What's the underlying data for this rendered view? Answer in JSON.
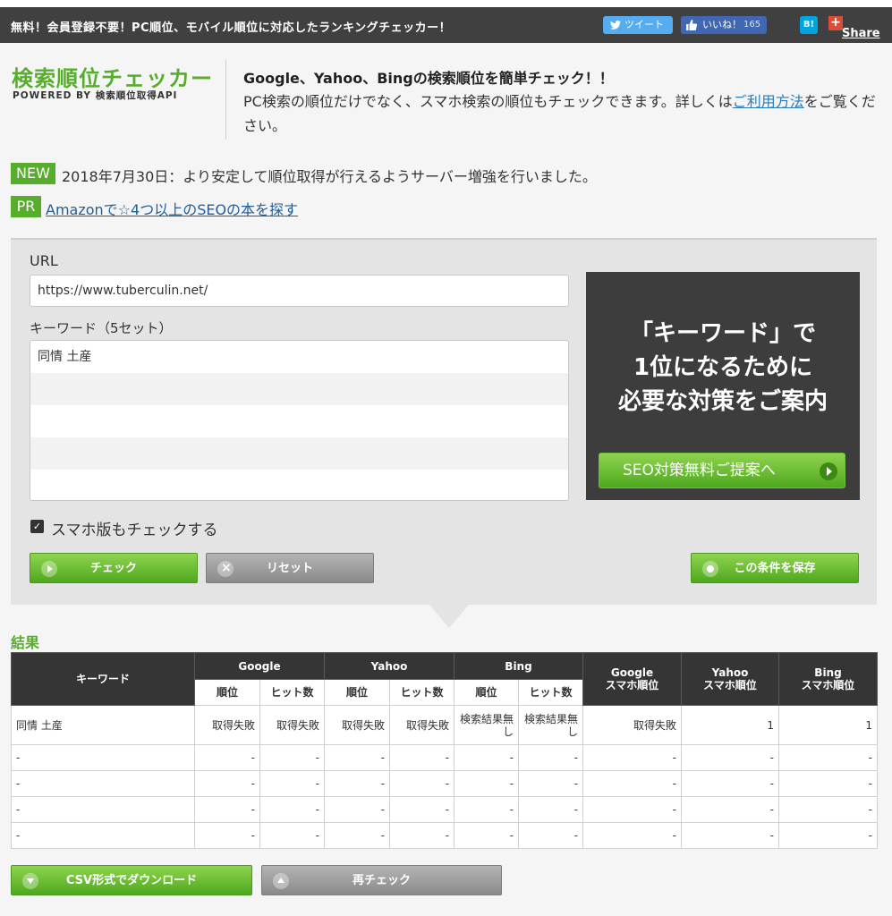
{
  "topbar": {
    "tagline": "無料！会員登録不要！PC順位、モバイル順位に対応したランキングチェッカー！",
    "tweet_label": "ツイート",
    "like_label": "いいね！",
    "like_count": "165",
    "hatena_label": "B!",
    "gplus_plus": "+",
    "share_label": "Share"
  },
  "header": {
    "logo_title": "検索順位チェッカー",
    "logo_sub": "POWERED BY 検索順位取得API",
    "intro_heading": "Google、Yahoo、Bingの検索順位を簡単チェック！！",
    "intro_text": "PC検索の順位だけでなく、スマホ検索の順位もチェックできます。詳しくは",
    "intro_link": "ご利用方法",
    "intro_tail": "をご覧ください。"
  },
  "news": {
    "new_badge": "NEW",
    "new_text": "2018年7月30日：より安定して順位取得が行えるようサーバー増強を行いました。",
    "pr_badge": "PR",
    "pr_link": "Amazonで☆4つ以上のSEOの本を探す"
  },
  "form": {
    "url_label": "URL",
    "url_value": "https://www.tuberculin.net/",
    "keyword_label": "キーワード（5セット）",
    "keywords": [
      "同情 土産",
      "",
      "",
      "",
      ""
    ],
    "smartphone_check_label": "スマホ版もチェックする",
    "smartphone_checked": true,
    "check_button": "チェック",
    "reset_button": "リセット",
    "save_button": "この条件を保存"
  },
  "ad": {
    "line1": "「キーワード」で",
    "line2": "1位になるために",
    "line3": "必要な対策をご案内",
    "button": "SEO対策無料ご提案へ"
  },
  "results": {
    "title": "結果",
    "headers": {
      "keyword": "キーワード",
      "google": "Google",
      "yahoo": "Yahoo",
      "bing": "Bing",
      "rank": "順位",
      "hits": "ヒット数",
      "google_sp_1": "Google",
      "google_sp_2": "スマホ順位",
      "yahoo_sp_1": "Yahoo",
      "yahoo_sp_2": "スマホ順位",
      "bing_sp_1": "Bing",
      "bing_sp_2": "スマホ順位"
    },
    "rows": [
      [
        "同情 土産",
        "取得失敗",
        "取得失敗",
        "取得失敗",
        "取得失敗",
        "検索結果無し",
        "検索結果無し",
        "取得失敗",
        "1",
        "1"
      ],
      [
        "-",
        "-",
        "-",
        "-",
        "-",
        "-",
        "-",
        "-",
        "-",
        "-"
      ],
      [
        "-",
        "-",
        "-",
        "-",
        "-",
        "-",
        "-",
        "-",
        "-",
        "-"
      ],
      [
        "-",
        "-",
        "-",
        "-",
        "-",
        "-",
        "-",
        "-",
        "-",
        "-"
      ],
      [
        "-",
        "-",
        "-",
        "-",
        "-",
        "-",
        "-",
        "-",
        "-",
        "-"
      ]
    ],
    "csv_button": "CSV形式でダウンロード",
    "recheck_button": "再チェック"
  }
}
